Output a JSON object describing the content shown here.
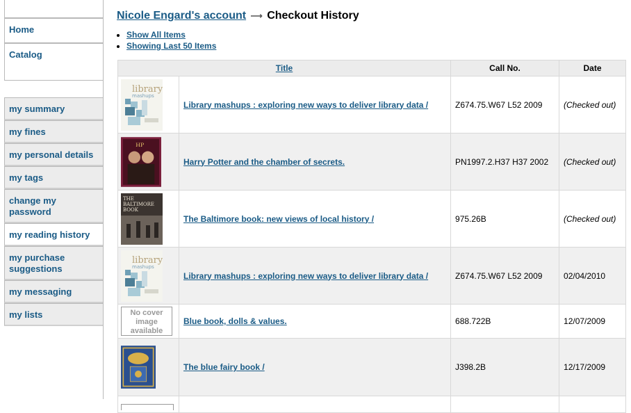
{
  "nav": {
    "top_items": [
      {
        "label": "Home"
      },
      {
        "label": "Catalog"
      }
    ],
    "user_items": [
      {
        "label": "my summary",
        "active": false
      },
      {
        "label": "my fines",
        "active": false
      },
      {
        "label": "my personal details",
        "active": false
      },
      {
        "label": "my tags",
        "active": false
      },
      {
        "label": "change my password",
        "active": false
      },
      {
        "label": "my reading history",
        "active": true
      },
      {
        "label": "my purchase suggestions",
        "active": false
      },
      {
        "label": "my messaging",
        "active": false
      },
      {
        "label": "my lists",
        "active": false
      }
    ]
  },
  "breadcrumb": {
    "account_link": "Nicole Engard's account",
    "separator": "⟶",
    "current": "Checkout History"
  },
  "view_links": {
    "show_all": "Show All Items",
    "show_last": "Showing Last 50 Items"
  },
  "table": {
    "headers": {
      "title": "Title",
      "callno": "Call No.",
      "date": "Date"
    },
    "no_cover_text": "No cover image available",
    "rows": [
      {
        "cover": "library-mashups-cover",
        "title": "Library mashups : exploring new ways to deliver library data /",
        "callno": "Z674.75.W67 L52 2009",
        "date": "(Checked out)",
        "checked_out": true
      },
      {
        "cover": "harry-potter-cover",
        "title": "Harry Potter and the chamber of secrets.",
        "callno": "PN1997.2.H37 H37 2002",
        "date": "(Checked out)",
        "checked_out": true
      },
      {
        "cover": "baltimore-book-cover",
        "title": "The Baltimore book: new views of local history /",
        "callno": "975.26B",
        "date": "(Checked out)",
        "checked_out": true
      },
      {
        "cover": "library-mashups-cover",
        "title": "Library mashups : exploring new ways to deliver library data /",
        "callno": "Z674.75.W67 L52 2009",
        "date": "02/04/2010",
        "checked_out": false
      },
      {
        "cover": "no-cover",
        "title": "Blue book, dolls & values.",
        "callno": "688.722B",
        "date": "12/07/2009",
        "checked_out": false
      },
      {
        "cover": "blue-fairy-book-cover",
        "title": "The blue fairy book /",
        "callno": "J398.2B",
        "date": "12/17/2009",
        "checked_out": false
      }
    ]
  }
}
